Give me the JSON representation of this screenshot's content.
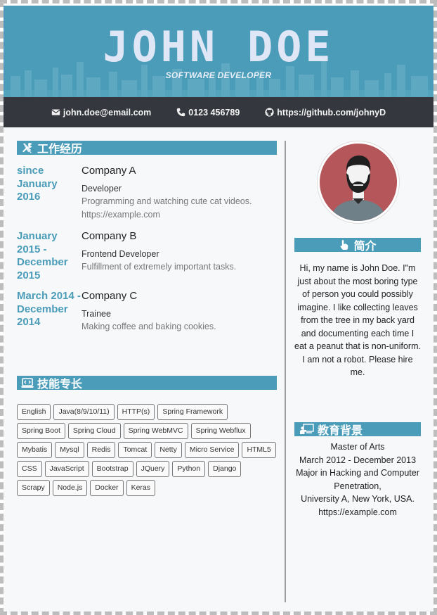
{
  "header": {
    "name": "JOHN DOE",
    "role": "SOFTWARE DEVELOPER"
  },
  "contact": {
    "email": "john.doe@email.com",
    "phone": "0123 456789",
    "github": "https://github.com/johnyD"
  },
  "sections": {
    "experience": "工作经历",
    "skills": "技能专长",
    "about": "简介",
    "education": "教育背景"
  },
  "jobs": [
    {
      "date_lines": [
        "since",
        "January",
        "2016"
      ],
      "company": "Company A",
      "title": "Developer",
      "desc": [
        "Programming and watching cute cat videos.",
        "https://example.com"
      ]
    },
    {
      "date_lines": [
        "January",
        "2015 -",
        "December",
        "2015"
      ],
      "company": "Company B",
      "title": "Frontend Developer",
      "desc": [
        "Fulfillment of extremely important tasks."
      ]
    },
    {
      "date_lines": [
        "March 2014 -",
        "December",
        "2014"
      ],
      "company": "Company C",
      "title": "Trainee",
      "desc": [
        "Making coffee and baking cookies."
      ]
    }
  ],
  "skills": [
    "English",
    "Java(8/9/10/11)",
    "HTTP(s)",
    "Spring Framework",
    "Spring Boot",
    "Spring Cloud",
    "Spring WebMVC",
    "Spring Webflux",
    "Mybatis",
    "Mysql",
    "Redis",
    "Tomcat",
    "Netty",
    "Micro Service",
    "HTML5",
    "CSS",
    "JavaScript",
    "Bootstrap",
    "JQuery",
    "Python",
    "Django",
    "Scrapy",
    "Node.js",
    "Docker",
    "Keras"
  ],
  "about": "Hi, my name is John Doe. I\"m just about the most boring type of person you could possibly imagine. I like collecting leaves from the tree in my back yard and documenting each time I eat a peanut that is non-uniform. I am not a robot. Please hire me.",
  "education": {
    "degree": "Master of Arts",
    "period": "March 2012 - December 2013",
    "major": "Major in Hacking and Computer Penetration,",
    "school": "University A, New York, USA.",
    "link": "https://example.com"
  },
  "colors": {
    "accent": "#4a9cb9",
    "contact_bar": "#34373d",
    "page_bg": "#f6f8fa"
  },
  "icons": {
    "email": "email-icon",
    "phone": "phone-icon",
    "github": "github-icon",
    "experience": "tools-icon",
    "skills": "laptop-code-icon",
    "about": "hand-pointer-icon",
    "education": "teacher-icon"
  }
}
